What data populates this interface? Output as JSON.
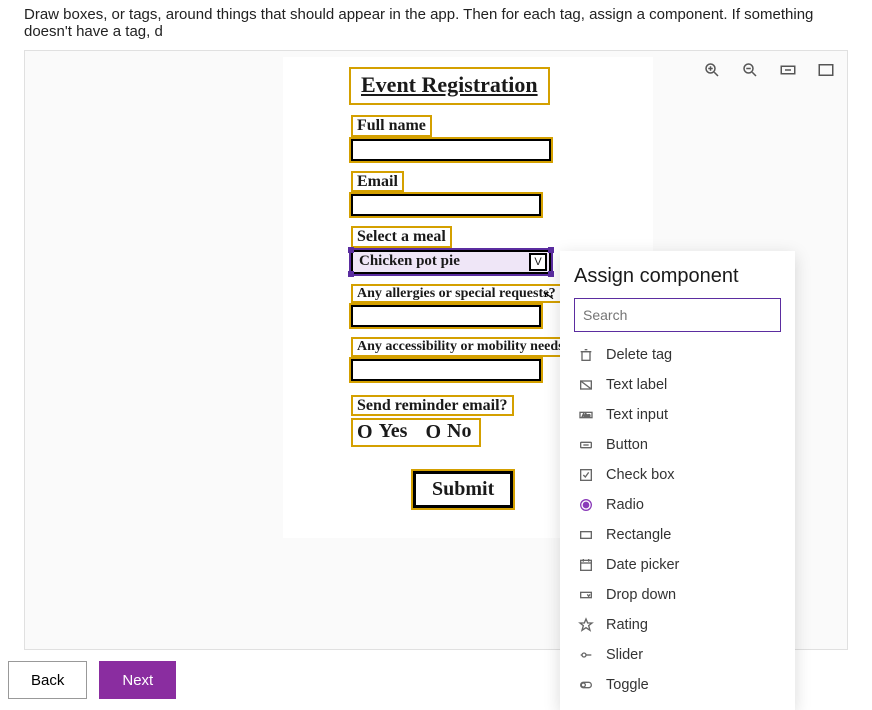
{
  "instruction": "Draw boxes, or tags, around things that should appear in the app. Then for each tag, assign a component. If something doesn't have a tag, d",
  "sketch": {
    "title": "Event Registration",
    "full_name_label": "Full name",
    "email_label": "Email",
    "meal_label": "Select a meal",
    "meal_value": "Chicken pot pie",
    "allergies_label": "Any allergies or special requests?",
    "accessibility_label": "Any accessibility or mobility needs?",
    "reminder_label": "Send reminder email?",
    "yes": "Yes",
    "no": "No",
    "submit": "Submit"
  },
  "panel": {
    "title": "Assign component",
    "search_placeholder": "Search",
    "items": {
      "delete": "Delete tag",
      "text_label": "Text label",
      "text_input": "Text input",
      "button": "Button",
      "check_box": "Check box",
      "radio": "Radio",
      "rectangle": "Rectangle",
      "date_picker": "Date picker",
      "drop_down": "Drop down",
      "rating": "Rating",
      "slider": "Slider",
      "toggle": "Toggle"
    }
  },
  "footer": {
    "back": "Back",
    "next": "Next"
  }
}
